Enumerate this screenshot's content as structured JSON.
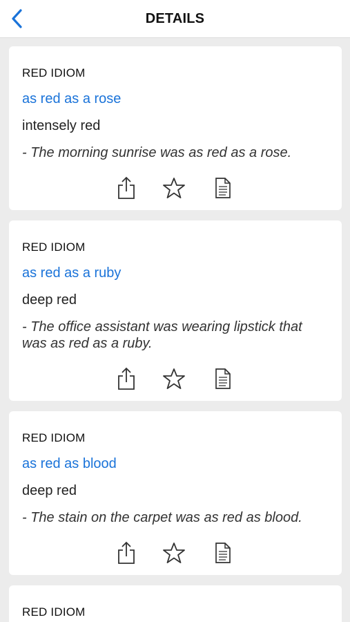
{
  "header": {
    "title": "DETAILS",
    "back_icon": "chevron-left-icon"
  },
  "accent_color": "#1a73d9",
  "cards": [
    {
      "category": "RED IDIOM",
      "idiom": "as red as a rose",
      "meaning": "intensely red",
      "example": "- The morning sunrise was as red as a rose."
    },
    {
      "category": "RED IDIOM",
      "idiom": "as red as a ruby",
      "meaning": "deep red",
      "example": "- The office assistant was wearing lipstick that was as red as a ruby."
    },
    {
      "category": "RED IDIOM",
      "idiom": "as red as blood",
      "meaning": "deep red",
      "example": "- The stain on the carpet was as red as blood."
    },
    {
      "category": "RED IDIOM"
    }
  ],
  "card_actions": [
    "share-icon",
    "star-icon",
    "document-icon"
  ]
}
